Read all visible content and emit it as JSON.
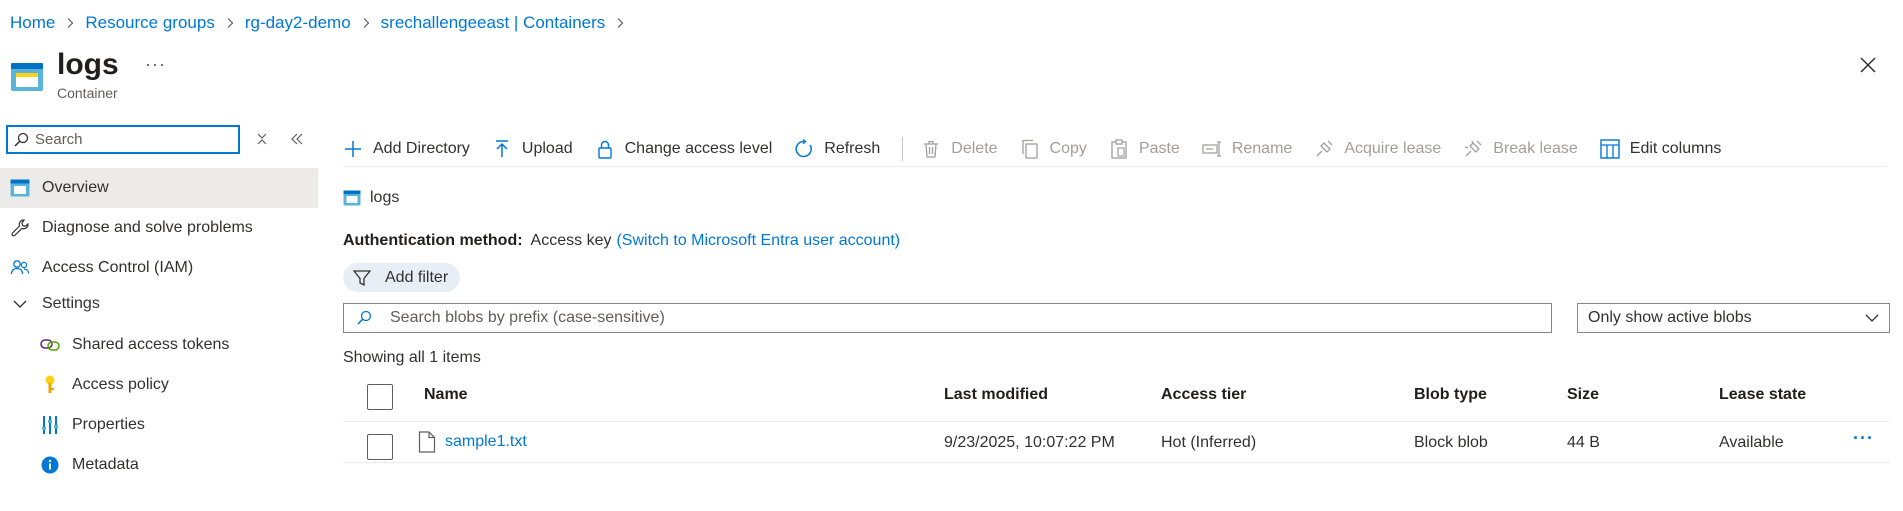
{
  "breadcrumb": [
    "Home",
    "Resource groups",
    "rg-day2-demo",
    "srechallengeeast | Containers"
  ],
  "header": {
    "title": "logs",
    "subtitle": "Container",
    "more": "···"
  },
  "sidebar": {
    "search_placeholder": "Search",
    "items": [
      {
        "label": "Overview",
        "icon": "container-icon",
        "active": true
      },
      {
        "label": "Diagnose and solve problems",
        "icon": "wrench-icon"
      },
      {
        "label": "Access Control (IAM)",
        "icon": "people-icon"
      },
      {
        "label": "Settings",
        "icon": "chevron-down-icon"
      },
      {
        "label": "Shared access tokens",
        "icon": "link-icon"
      },
      {
        "label": "Access policy",
        "icon": "key-icon"
      },
      {
        "label": "Properties",
        "icon": "properties-icon"
      },
      {
        "label": "Metadata",
        "icon": "info-icon"
      }
    ]
  },
  "toolbar": {
    "add_directory": "Add Directory",
    "upload": "Upload",
    "change_access": "Change access level",
    "refresh": "Refresh",
    "delete": "Delete",
    "copy": "Copy",
    "paste": "Paste",
    "rename": "Rename",
    "acquire_lease": "Acquire lease",
    "break_lease": "Break lease",
    "edit_columns": "Edit columns"
  },
  "container_path": "logs",
  "auth": {
    "label": "Authentication method:",
    "value": "Access key",
    "switch_link": "(Switch to Microsoft Entra user account)"
  },
  "filter": {
    "add_filter": "Add filter"
  },
  "blob_search": {
    "placeholder": "Search blobs by prefix (case-sensitive)"
  },
  "blob_filter_dropdown": {
    "selected": "Only show active blobs"
  },
  "showing_text": "Showing all 1 items",
  "table": {
    "columns": [
      "Name",
      "Last modified",
      "Access tier",
      "Blob type",
      "Size",
      "Lease state"
    ],
    "rows": [
      {
        "name": "sample1.txt",
        "last_modified": "9/23/2025, 10:07:22 PM",
        "access_tier": "Hot (Inferred)",
        "blob_type": "Block blob",
        "size": "44 B",
        "lease_state": "Available",
        "more": "···"
      }
    ]
  },
  "colors": {
    "accent": "#0078d4",
    "disabled": "#a19f9d",
    "active_bg": "#edebe9"
  }
}
